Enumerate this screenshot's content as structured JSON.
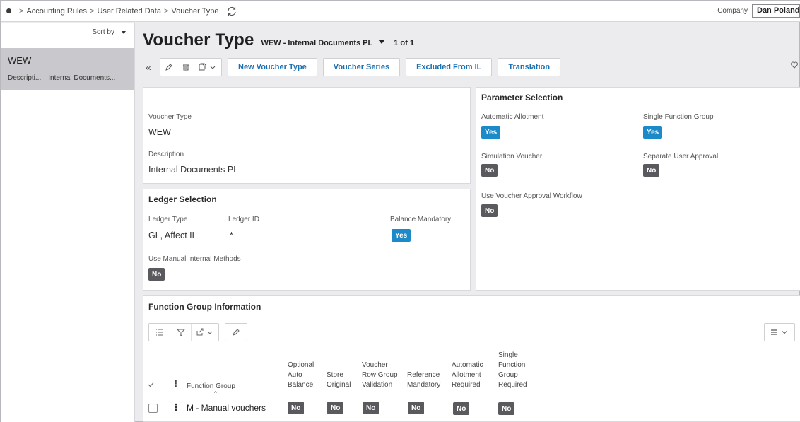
{
  "breadcrumb": {
    "items": [
      "Accounting Rules",
      "User Related Data",
      "Voucher Type"
    ]
  },
  "company": {
    "label": "Company",
    "value": "Dan Poland"
  },
  "left_panel": {
    "sort_label": "Sort by",
    "items": [
      {
        "title": "WEW",
        "desc_label": "Descripti...",
        "desc_value": "Internal Documents..."
      }
    ]
  },
  "header": {
    "title": "Voucher Type",
    "record": "WEW - Internal Documents PL",
    "count": "1 of 1"
  },
  "toolbar": {
    "new_label": "New Voucher Type",
    "series_label": "Voucher Series",
    "excluded_label": "Excluded From IL",
    "translation_label": "Translation"
  },
  "general": {
    "voucher_type_label": "Voucher Type",
    "voucher_type_value": "WEW",
    "description_label": "Description",
    "description_value": "Internal Documents PL"
  },
  "ledger": {
    "title": "Ledger Selection",
    "type_label": "Ledger Type",
    "type_value": "GL, Affect IL",
    "id_label": "Ledger ID",
    "id_value": "*",
    "balance_label": "Balance Mandatory",
    "balance_value": "Yes",
    "manual_label": "Use Manual Internal Methods",
    "manual_value": "No"
  },
  "parameters": {
    "title": "Parameter Selection",
    "auto_allot_label": "Automatic Allotment",
    "auto_allot_value": "Yes",
    "single_fg_label": "Single Function Group",
    "single_fg_value": "Yes",
    "sim_label": "Simulation Voucher",
    "sim_value": "No",
    "sep_label": "Separate User Approval",
    "sep_value": "No",
    "workflow_label": "Use Voucher Approval Workflow",
    "workflow_value": "No"
  },
  "function_group": {
    "title": "Function Group Information",
    "columns": [
      {
        "lines": [
          "Function Group"
        ]
      },
      {
        "lines": [
          "Optional",
          "Auto",
          "Balance"
        ]
      },
      {
        "lines": [
          "Store",
          "Original"
        ]
      },
      {
        "lines": [
          "Voucher",
          "Row Group",
          "Validation"
        ]
      },
      {
        "lines": [
          "Reference",
          "Mandatory"
        ]
      },
      {
        "lines": [
          "Automatic",
          "Allotment",
          "Required"
        ]
      },
      {
        "lines": [
          "Single",
          "Function",
          "Group",
          "Required"
        ]
      }
    ],
    "rows": [
      {
        "group": "M - Manual vouchers",
        "values": [
          "No",
          "No",
          "No",
          "No",
          "No",
          "No"
        ]
      }
    ]
  }
}
